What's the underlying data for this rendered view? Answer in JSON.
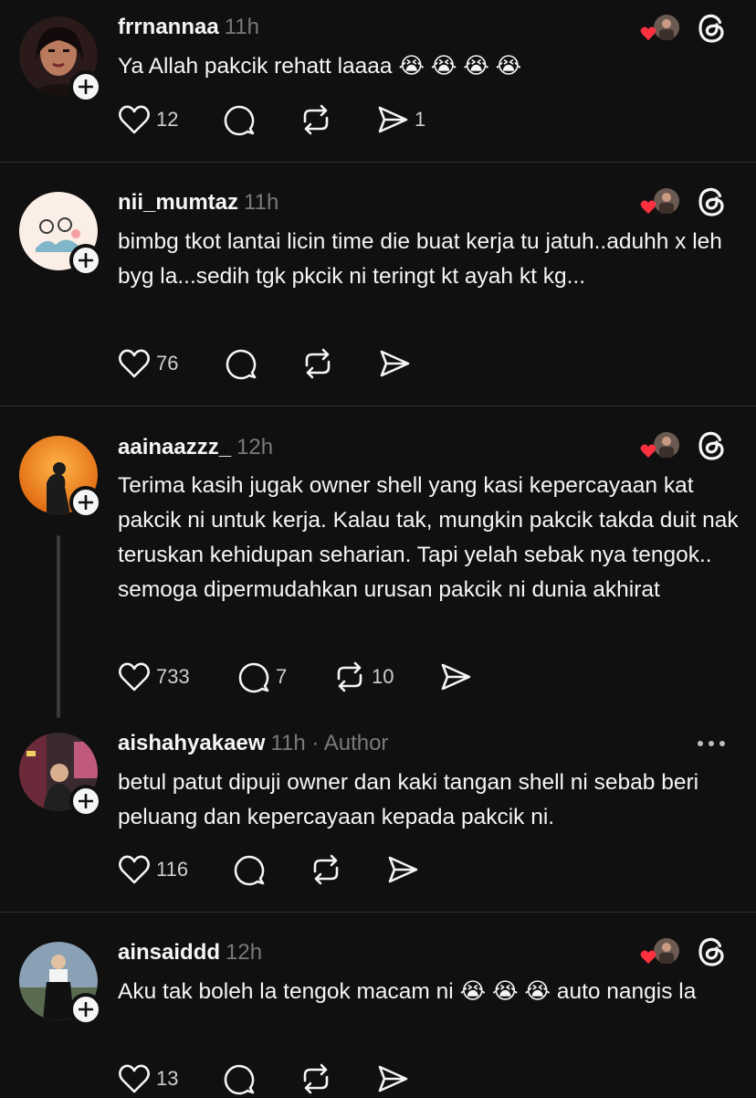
{
  "posts": [
    {
      "username": "frrnannaa",
      "time": "11h",
      "text": "Ya Allah pakcik rehatt laaaa 😭 😭 😭 😭",
      "likes": "12",
      "replies": "",
      "reposts": "",
      "shares": "1"
    },
    {
      "username": "nii_mumtaz",
      "time": "11h",
      "text": "bimbg tkot lantai licin time die buat kerja tu jatuh..aduhh x leh byg la...sedih tgk pkcik ni teringt kt ayah kt kg...",
      "likes": "76",
      "replies": "",
      "reposts": "",
      "shares": ""
    },
    {
      "username": "aainaazzz_",
      "time": "12h",
      "text": "Terima kasih jugak owner shell yang kasi kepercayaan kat pakcik ni untuk kerja. Kalau tak, mungkin pakcik takda duit nak teruskan kehidupan seharian. Tapi yelah sebak nya tengok.. semoga dipermudahkan urusan pakcik ni dunia akhirat",
      "likes": "733",
      "replies": "7",
      "reposts": "10",
      "shares": ""
    },
    {
      "username": "aishahyakaew",
      "time": "11h",
      "author_label": "· Author",
      "text": "betul patut dipuji owner dan kaki tangan shell ni sebab beri peluang dan kepercayaan kepada pakcik ni.",
      "likes": "116",
      "replies": "",
      "reposts": "",
      "shares": ""
    },
    {
      "username": "ainsaiddd",
      "time": "12h",
      "text": "Aku tak boleh la tengok macam ni 😭 😭 😭  auto nangis la",
      "likes": "13",
      "replies": "",
      "reposts": "",
      "shares": ""
    }
  ],
  "icons": {
    "like": "heart-icon",
    "reply": "comment-icon",
    "repost": "repost-icon",
    "share": "send-icon",
    "threads": "threads-logo-icon",
    "follow": "plus-icon",
    "more": "more-icon"
  },
  "colors": {
    "background": "#101010",
    "text": "#f3f5f7",
    "muted": "#7a7a7a",
    "divider": "#2e2e2e",
    "heart_red": "#ff3040"
  }
}
